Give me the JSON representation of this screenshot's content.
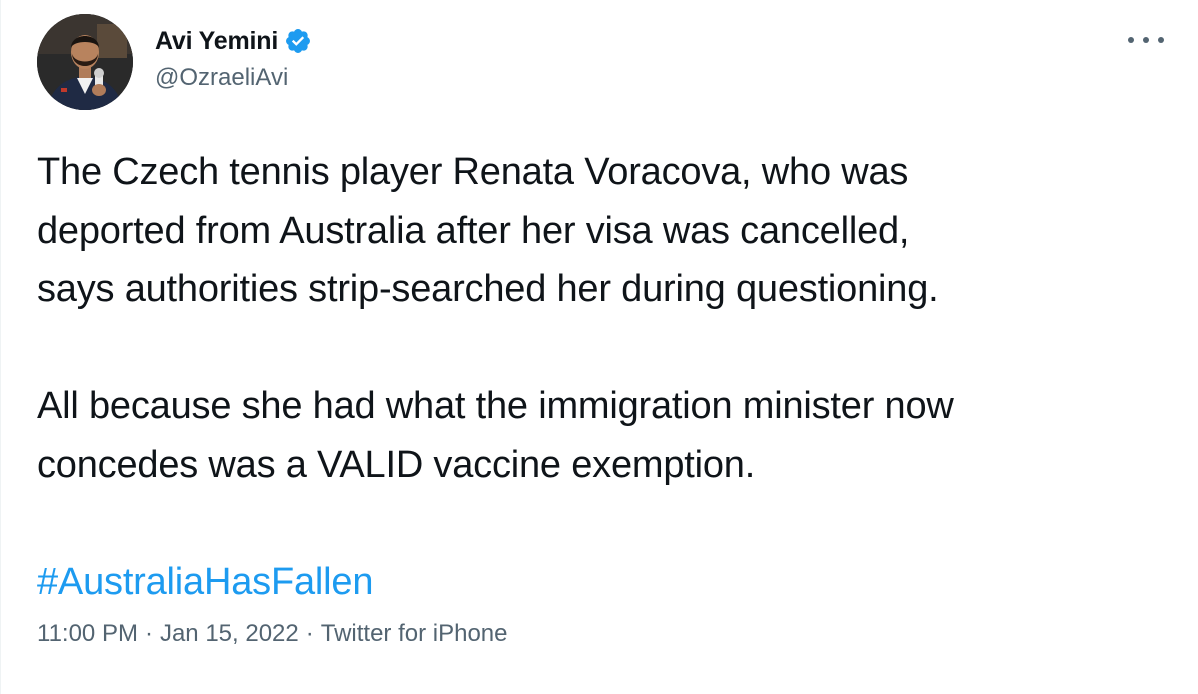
{
  "author": {
    "display_name": "Avi Yemini",
    "handle": "@OzraeliAvi",
    "verified_badge_icon": "verified-badge-icon",
    "avatar_icon": "profile-photo"
  },
  "menu": {
    "more_icon": "more-options-icon"
  },
  "tweet": {
    "lines_p1": [
      "The Czech tennis player Renata Voracova, who was",
      "deported from Australia after her visa was cancelled,",
      "says authorities strip-searched her during questioning."
    ],
    "lines_p2": [
      "All because she had what the immigration minister now",
      "concedes was a VALID vaccine exemption."
    ],
    "hashtag": "#AustraliaHasFallen"
  },
  "meta": {
    "time": "11:00 PM",
    "separator": "·",
    "date": "Jan 15, 2022",
    "source": "Twitter for iPhone"
  },
  "colors": {
    "text": "#0f1419",
    "secondary": "#536471",
    "accent": "#1d9bf0"
  }
}
